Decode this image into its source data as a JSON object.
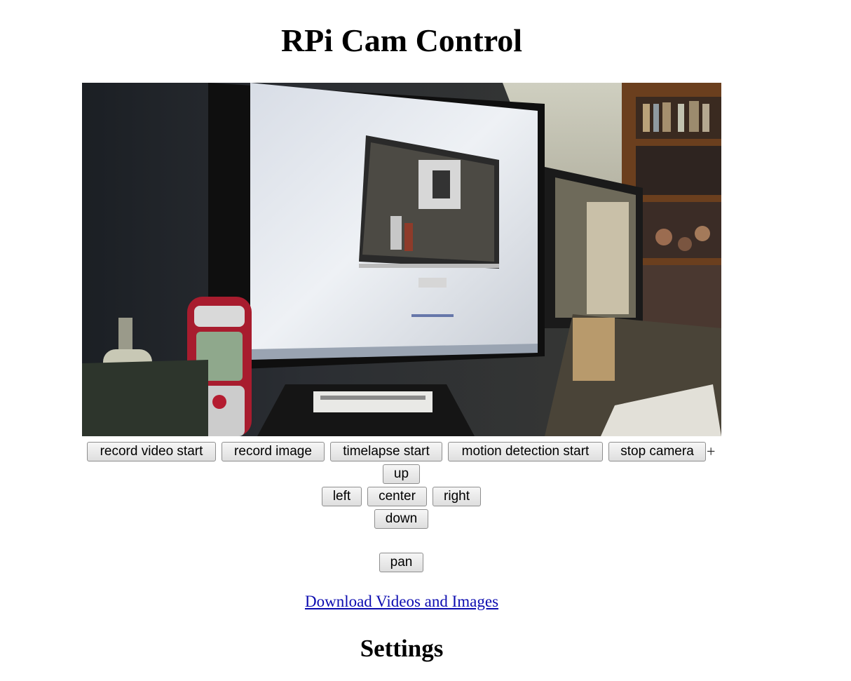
{
  "header": {
    "title": "RPi Cam Control"
  },
  "preview": {
    "icon": "camera-preview-image"
  },
  "controls": {
    "record_video": "record video start",
    "record_image": "record image",
    "timelapse": "timelapse start",
    "motion_detection": "motion detection start",
    "stop_camera": "stop camera",
    "expand": "+"
  },
  "pantilt": {
    "up": "up",
    "left": "left",
    "center": "center",
    "right": "right",
    "down": "down",
    "pan": "pan"
  },
  "links": {
    "download": "Download Videos and Images"
  },
  "settings": {
    "heading": "Settings"
  },
  "colors": {
    "link": "#0b0bb0",
    "button_bg": "#e8e8e8"
  }
}
